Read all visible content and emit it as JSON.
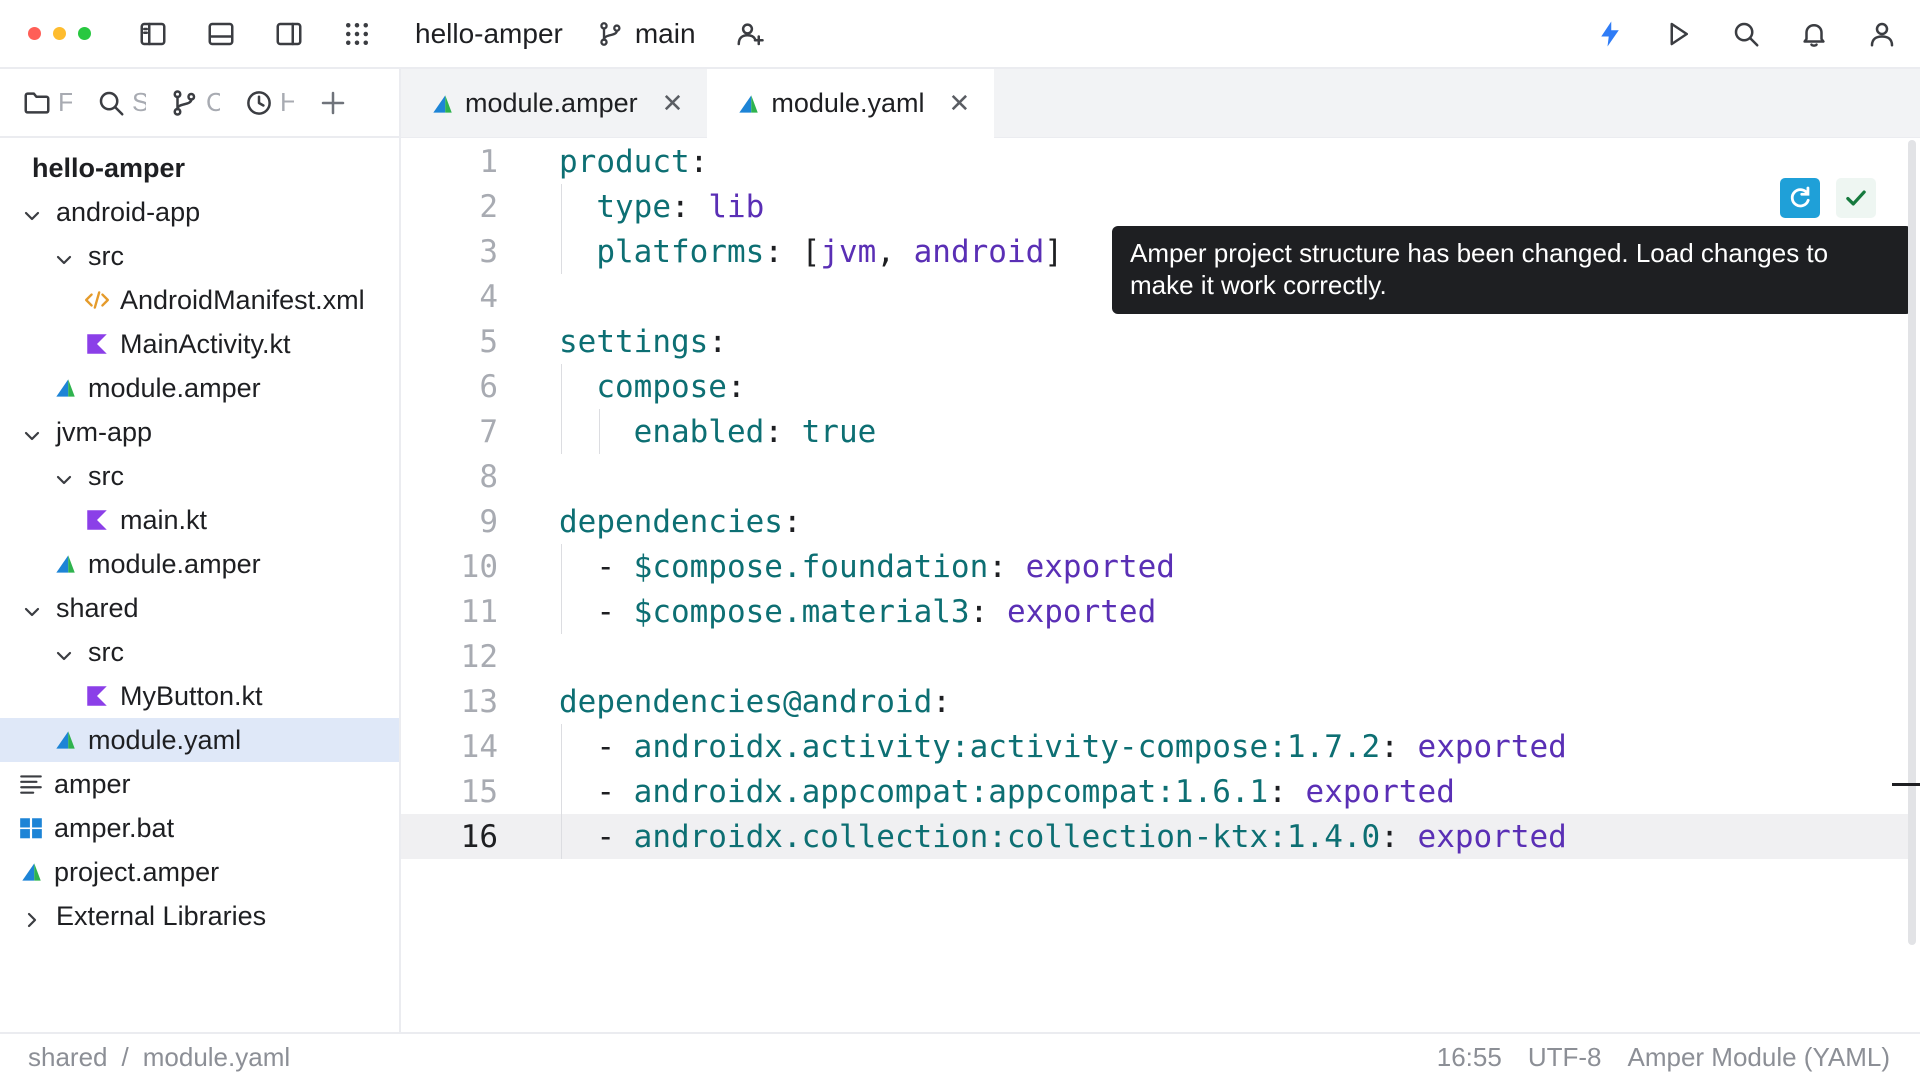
{
  "titlebar": {
    "project": "hello-amper",
    "branch": "main"
  },
  "sidebar": {
    "tabs": [
      {
        "label": "F"
      },
      {
        "label": "S"
      },
      {
        "label": "C"
      },
      {
        "label": "H"
      }
    ],
    "tree": [
      {
        "label": "hello-amper",
        "kind": "root"
      },
      {
        "label": "android-app",
        "depth": 0,
        "chev": "down",
        "icon": "none"
      },
      {
        "label": "src",
        "depth": 1,
        "chev": "down",
        "icon": "none"
      },
      {
        "label": "AndroidManifest.xml",
        "depth": 2,
        "icon": "xml"
      },
      {
        "label": "MainActivity.kt",
        "depth": 2,
        "icon": "kotlin"
      },
      {
        "label": "module.amper",
        "depth": 1,
        "icon": "amper"
      },
      {
        "label": "jvm-app",
        "depth": 0,
        "chev": "down",
        "icon": "none"
      },
      {
        "label": "src",
        "depth": 1,
        "chev": "down",
        "icon": "none"
      },
      {
        "label": "main.kt",
        "depth": 2,
        "icon": "kotlin"
      },
      {
        "label": "module.amper",
        "depth": 1,
        "icon": "amper"
      },
      {
        "label": "shared",
        "depth": 0,
        "chev": "down",
        "icon": "none"
      },
      {
        "label": "src",
        "depth": 1,
        "chev": "down",
        "icon": "none"
      },
      {
        "label": "MyButton.kt",
        "depth": 2,
        "icon": "kotlin"
      },
      {
        "label": "module.yaml",
        "depth": 1,
        "icon": "amper",
        "selected": true
      },
      {
        "label": "amper",
        "depth": -1,
        "icon": "text"
      },
      {
        "label": "amper.bat",
        "depth": -1,
        "icon": "windows"
      },
      {
        "label": "project.amper",
        "depth": -1,
        "icon": "amper"
      },
      {
        "label": "External Libraries",
        "depth": 0,
        "chev": "right",
        "icon": "none"
      }
    ]
  },
  "editor_tabs": [
    {
      "label": "module.amper",
      "active": false
    },
    {
      "label": "module.yaml",
      "active": true
    }
  ],
  "code": [
    [
      [
        "k",
        "product"
      ],
      [
        "p",
        ":"
      ]
    ],
    [
      [
        "p",
        "  "
      ],
      [
        "k",
        "type"
      ],
      [
        "p",
        ": "
      ],
      [
        "v",
        "lib"
      ]
    ],
    [
      [
        "p",
        "  "
      ],
      [
        "k",
        "platforms"
      ],
      [
        "p",
        ": ["
      ],
      [
        "v",
        "jvm"
      ],
      [
        "p",
        ", "
      ],
      [
        "v",
        "android"
      ],
      [
        "p",
        "]"
      ]
    ],
    [],
    [
      [
        "k",
        "settings"
      ],
      [
        "p",
        ":"
      ]
    ],
    [
      [
        "p",
        "  "
      ],
      [
        "k",
        "compose"
      ],
      [
        "p",
        ":"
      ]
    ],
    [
      [
        "p",
        "    "
      ],
      [
        "k",
        "enabled"
      ],
      [
        "p",
        ": "
      ],
      [
        "k",
        "true"
      ]
    ],
    [],
    [
      [
        "k",
        "dependencies"
      ],
      [
        "p",
        ":"
      ]
    ],
    [
      [
        "p",
        "  - "
      ],
      [
        "k",
        "$compose.foundation"
      ],
      [
        "p",
        ": "
      ],
      [
        "v",
        "exported"
      ]
    ],
    [
      [
        "p",
        "  - "
      ],
      [
        "k",
        "$compose.material3"
      ],
      [
        "p",
        ": "
      ],
      [
        "v",
        "exported"
      ]
    ],
    [],
    [
      [
        "k",
        "dependencies@android"
      ],
      [
        "p",
        ":"
      ]
    ],
    [
      [
        "p",
        "  - "
      ],
      [
        "k",
        "androidx.activity:activity-compose:1.7.2"
      ],
      [
        "p",
        ": "
      ],
      [
        "v",
        "exported"
      ]
    ],
    [
      [
        "p",
        "  - "
      ],
      [
        "k",
        "androidx.appcompat:appcompat:1.6.1"
      ],
      [
        "p",
        ": "
      ],
      [
        "v",
        "exported"
      ]
    ],
    [
      [
        "p",
        "  - "
      ],
      [
        "k",
        "androidx.collection:collection-ktx:1.4.0"
      ],
      [
        "p",
        ": "
      ],
      [
        "v",
        "exported"
      ]
    ]
  ],
  "current_line": 16,
  "tooltip": {
    "text": "Amper project structure has been changed. Load changes to make it work correctly."
  },
  "statusbar": {
    "crumbs": [
      "shared",
      "/",
      "module.yaml"
    ],
    "position": "16:55",
    "encoding": "UTF-8",
    "filetype": "Amper Module (YAML)"
  },
  "colors": {
    "accent": "#2f7cf6",
    "amper_green": "#2fb34e",
    "amper_blue": "#1d84d6",
    "kotlin_purple": "#8b3fe8",
    "xml_orange": "#e59b2b"
  }
}
